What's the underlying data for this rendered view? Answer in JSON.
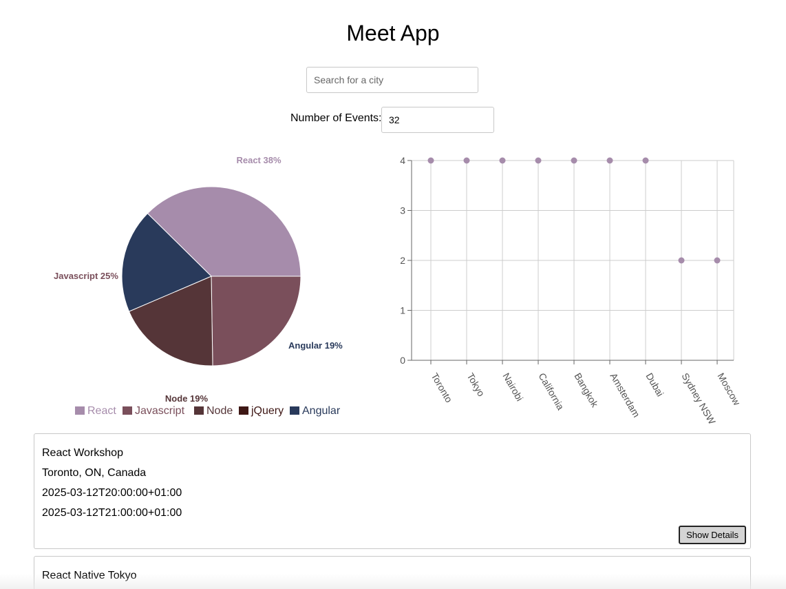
{
  "app": {
    "title": "Meet App"
  },
  "search": {
    "placeholder": "Search for a city",
    "value": ""
  },
  "number_of_events": {
    "label": "Number of Events:",
    "value": "32"
  },
  "chart_data": [
    {
      "type": "pie",
      "categories": [
        "React",
        "Javascript",
        "Node",
        "jQuery",
        "Angular"
      ],
      "values": [
        38,
        25,
        19,
        0,
        19
      ],
      "slice_labels": [
        "React 38%",
        "Javascript 25%",
        "Node 19%",
        "",
        "Angular 19%"
      ],
      "colors": [
        "#a68cab",
        "#7a4f5b",
        "#553538",
        "#3e1715",
        "#293a5b"
      ],
      "legend": "bottom"
    },
    {
      "type": "scatter",
      "categories": [
        "Toronto",
        "Tokyo",
        "Nairobi",
        "California",
        "Bangkok",
        "Amsterdam",
        "Dubai",
        "Sydney NSW",
        "Moscow"
      ],
      "values": [
        4,
        4,
        4,
        4,
        4,
        4,
        4,
        2,
        2
      ],
      "yticks": [
        "0",
        "1",
        "2",
        "3",
        "4"
      ],
      "ylim": [
        0,
        4
      ],
      "grid": true,
      "point_color": "#a68cab"
    }
  ],
  "events": [
    {
      "summary": "React Workshop",
      "location": "Toronto, ON, Canada",
      "start": "2025-03-12T20:00:00+01:00",
      "end": "2025-03-12T21:00:00+01:00",
      "button_label": "Show Details"
    },
    {
      "summary": "React Native Tokyo"
    }
  ]
}
